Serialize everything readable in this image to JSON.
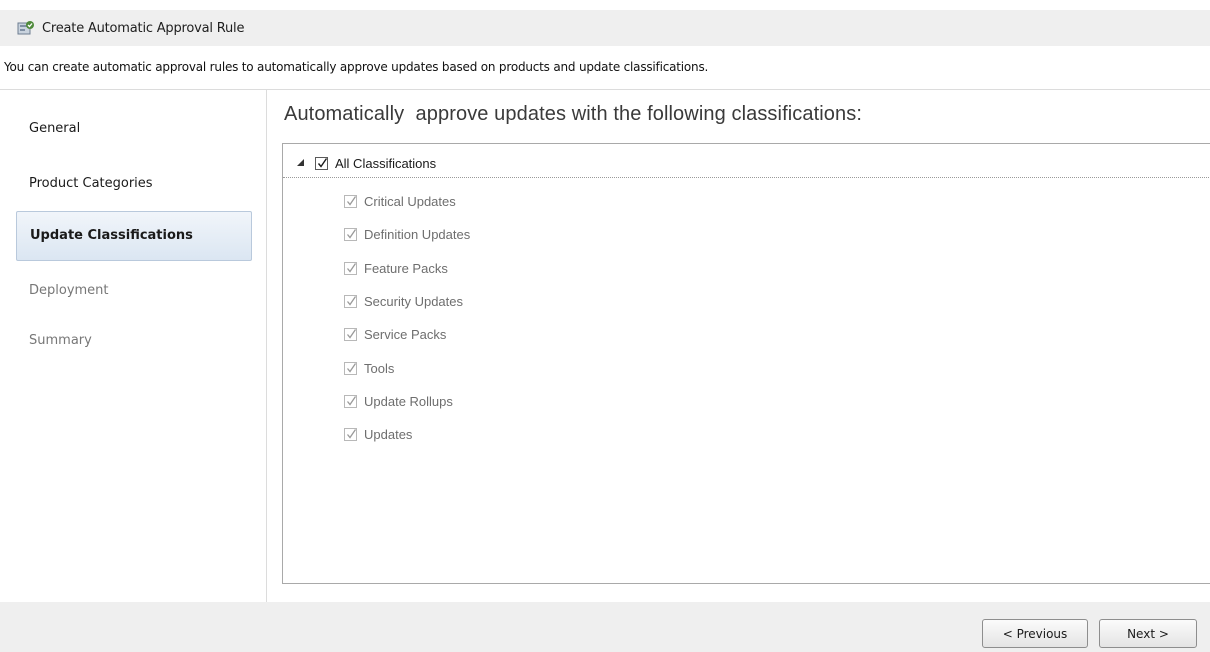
{
  "window": {
    "title": "Create Automatic Approval Rule"
  },
  "description": "You can create automatic approval rules to automatically approve updates based on products and update classifications.",
  "sidebar": {
    "items": [
      {
        "label": "General",
        "state": "normal"
      },
      {
        "label": "Product Categories",
        "state": "normal"
      },
      {
        "label": "Update Classifications",
        "state": "selected"
      },
      {
        "label": "Deployment",
        "state": "disabled"
      },
      {
        "label": "Summary",
        "state": "disabled"
      }
    ]
  },
  "main": {
    "heading": "Automatically  approve updates with the following classifications:",
    "tree": {
      "root": {
        "label": "All Classifications",
        "checked": true,
        "expanded": true
      },
      "children": [
        {
          "label": "Critical Updates",
          "checked": true,
          "enabled": false
        },
        {
          "label": "Definition Updates",
          "checked": true,
          "enabled": false
        },
        {
          "label": "Feature Packs",
          "checked": true,
          "enabled": false
        },
        {
          "label": "Security Updates",
          "checked": true,
          "enabled": false
        },
        {
          "label": "Service Packs",
          "checked": true,
          "enabled": false
        },
        {
          "label": "Tools",
          "checked": true,
          "enabled": false
        },
        {
          "label": "Update Rollups",
          "checked": true,
          "enabled": false
        },
        {
          "label": "Updates",
          "checked": true,
          "enabled": false
        }
      ]
    }
  },
  "footer": {
    "previous_label": "< Previous",
    "next_label": "Next >"
  }
}
